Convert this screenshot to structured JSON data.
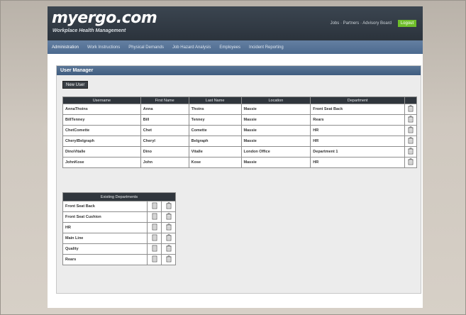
{
  "header": {
    "logo_main": "myergo.com",
    "tagline": "Workplace Health Management",
    "links": "Jobs · Partners · Advisory Board",
    "logout_label": "Logout"
  },
  "nav": {
    "items": [
      {
        "label": "Administration"
      },
      {
        "label": "Work Instructions"
      },
      {
        "label": "Physical Demands"
      },
      {
        "label": "Job Hazard Analysis"
      },
      {
        "label": "Employees"
      },
      {
        "label": "Incident Reporting"
      }
    ]
  },
  "user_manager": {
    "title": "User Manager",
    "new_user_label": "New User",
    "columns": [
      "Username",
      "First Name",
      "Last Name",
      "Location",
      "Department"
    ],
    "rows": [
      {
        "username": "AnnaThoins",
        "first": "Anna",
        "last": "Thoins",
        "location": "Massie",
        "department": "Front Seat Back"
      },
      {
        "username": "BillTenney",
        "first": "Bill",
        "last": "Tenney",
        "location": "Massie",
        "department": "Rears"
      },
      {
        "username": "ChetComette",
        "first": "Chet",
        "last": "Comette",
        "location": "Massie",
        "department": "HR"
      },
      {
        "username": "CherylBelgraph",
        "first": "Cheryl",
        "last": "Belgraph",
        "location": "Massie",
        "department": "HR"
      },
      {
        "username": "DinoVitalle",
        "first": "Dino",
        "last": "Vitalle",
        "location": "London Office",
        "department": "Department 1"
      },
      {
        "username": "JohnKose",
        "first": "John",
        "last": "Kose",
        "location": "Massie",
        "department": "HR"
      }
    ]
  },
  "departments": {
    "title": "Existing Departments",
    "items": [
      "Front Seat Back",
      "Front Seat Cushion",
      "HR",
      "Main Line",
      "Quality",
      "Rears"
    ]
  },
  "colors": {
    "header_bg": "#2f3740",
    "nav_bg": "#5776a0",
    "accent_green": "#8ec63f",
    "logout_green": "#6fbf2a",
    "table_header_bg": "#30363d"
  }
}
